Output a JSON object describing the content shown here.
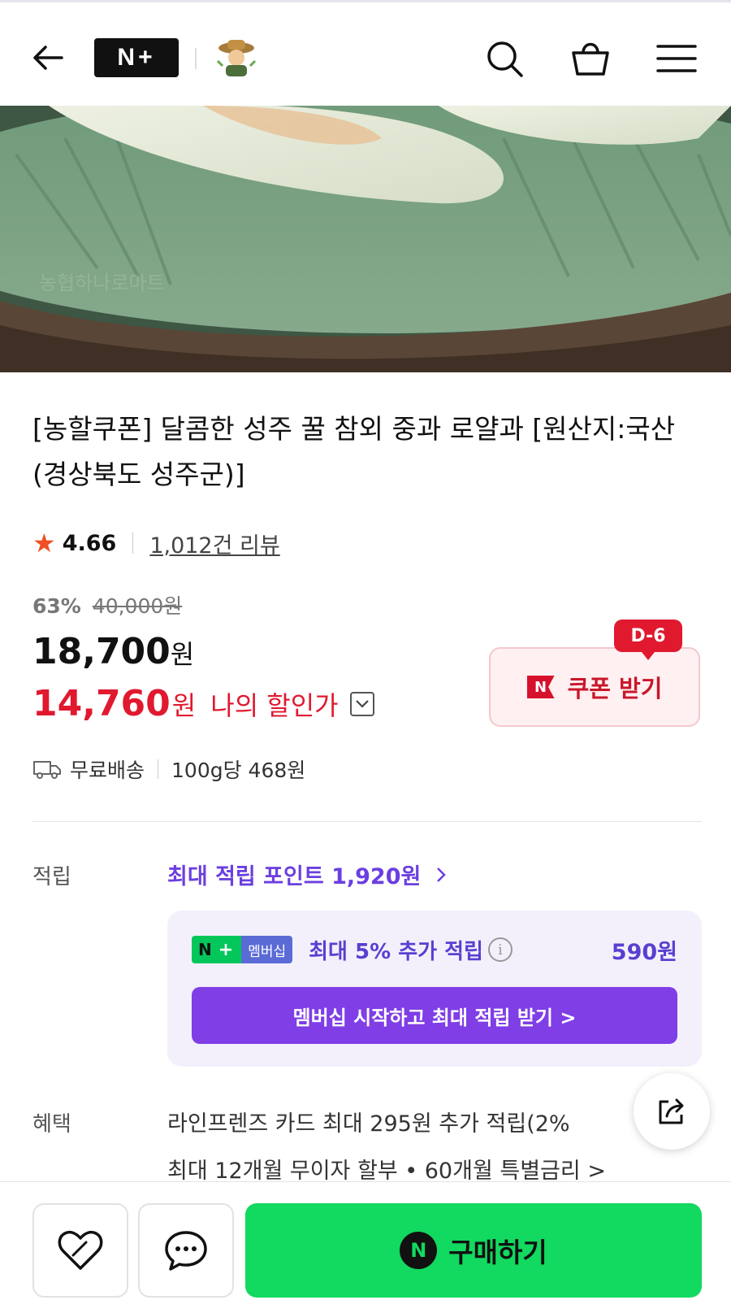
{
  "header": {
    "logo_text": "N+",
    "back_icon": "arrow-left-icon",
    "search_icon": "search-icon",
    "cart_icon": "shopping-bag-icon",
    "menu_icon": "hamburger-menu-icon"
  },
  "product": {
    "title": "[농할쿠폰] 달콤한 성주 꿀 참외 중과 로얄과 [원산지:국산(경상북도 성주군)]",
    "rating": "4.66",
    "review_count": "1,012건 리뷰",
    "discount_percent": "63%",
    "original_price": "40,000원",
    "price": "18,700",
    "price_unit": "원",
    "my_price": "14,760",
    "my_price_unit": "원",
    "my_price_label": "나의 할인가",
    "shipping": "무료배송",
    "unit_price": "100g당 468원"
  },
  "coupon": {
    "dday": "D-6",
    "label": "쿠폰 받기",
    "badge": "N"
  },
  "points": {
    "section_label": "적립",
    "max_points_link": "최대 적립 포인트 1,920원",
    "membership_badge_n": "N",
    "membership_badge_label": "멤버십",
    "membership_text": "최대 5% 추가 적립",
    "membership_amount": "590원",
    "membership_cta": "멤버십 시작하고 최대 적립 받기 >"
  },
  "benefits": {
    "section_label": "혜택",
    "line1": "라인프렌즈 카드 최대 295원 추가 적립(2%",
    "line2": "최대 12개월 무이자 할부 • 60개월 특별금리 >"
  },
  "bottom": {
    "buy_label": "구매하기",
    "buy_badge": "N"
  },
  "colors": {
    "accent_red": "#e0192f",
    "accent_purple": "#6b3fe0",
    "naver_green": "#12d95f"
  }
}
